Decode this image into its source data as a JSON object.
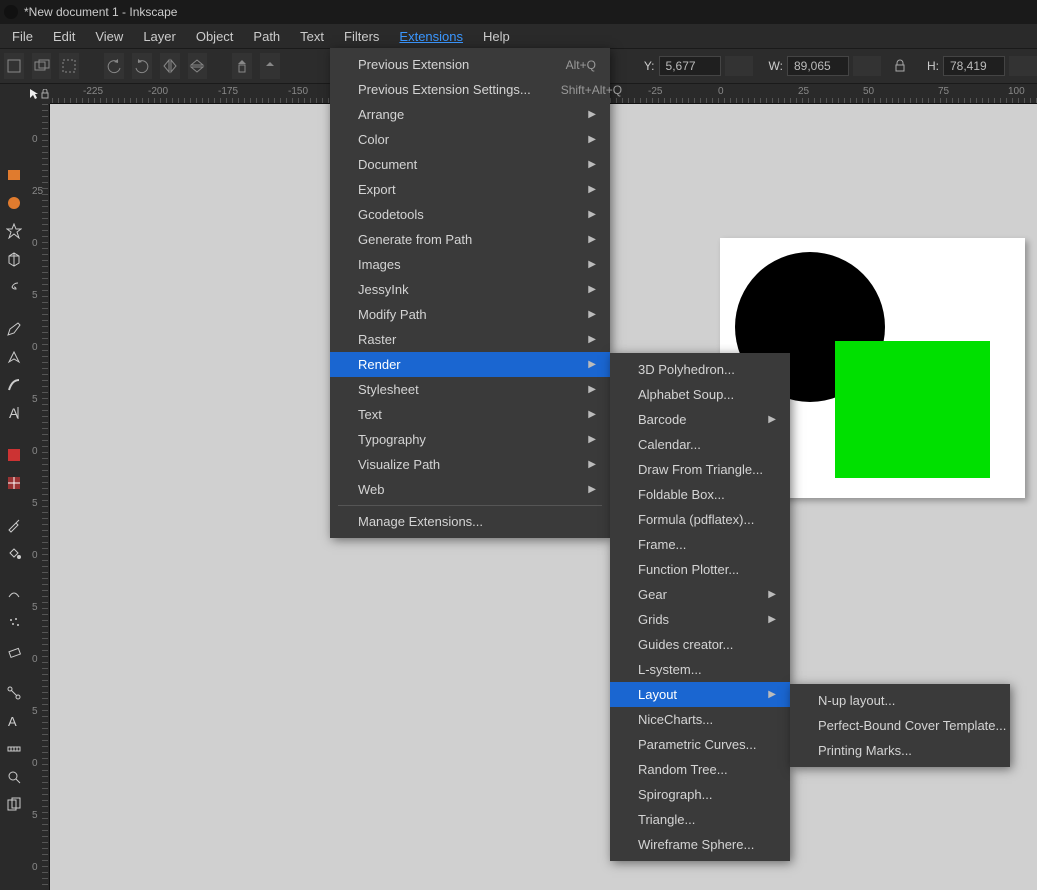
{
  "title": "*New document 1 - Inkscape",
  "menubar": [
    "File",
    "Edit",
    "View",
    "Layer",
    "Object",
    "Path",
    "Text",
    "Filters",
    "Extensions",
    "Help"
  ],
  "menubar_active": "Extensions",
  "coords": {
    "y_label": "Y:",
    "y": "5,677",
    "w_label": "W:",
    "w": "89,065",
    "h_label": "H:",
    "h": "78,419"
  },
  "ruler_h": [
    "-225",
    "-200",
    "-175",
    "-150",
    "-25",
    "0",
    "25",
    "50",
    "75",
    "100"
  ],
  "ruler_v": [
    "0",
    "25",
    "0",
    "5",
    "0",
    "5",
    "0",
    "5",
    "0",
    "5",
    "0",
    "5",
    "0",
    "5",
    "0"
  ],
  "ext_menu": [
    {
      "label": "Previous Extension",
      "shortcut": "Alt+Q"
    },
    {
      "label": "Previous Extension Settings...",
      "shortcut": "Shift+Alt+Q"
    },
    {
      "label": "Arrange",
      "sub": true
    },
    {
      "label": "Color",
      "sub": true
    },
    {
      "label": "Document",
      "sub": true
    },
    {
      "label": "Export",
      "sub": true
    },
    {
      "label": "Gcodetools",
      "sub": true
    },
    {
      "label": "Generate from Path",
      "sub": true
    },
    {
      "label": "Images",
      "sub": true
    },
    {
      "label": "JessyInk",
      "sub": true
    },
    {
      "label": "Modify Path",
      "sub": true
    },
    {
      "label": "Raster",
      "sub": true
    },
    {
      "label": "Render",
      "sub": true,
      "sel": true
    },
    {
      "label": "Stylesheet",
      "sub": true
    },
    {
      "label": "Text",
      "sub": true
    },
    {
      "label": "Typography",
      "sub": true
    },
    {
      "label": "Visualize Path",
      "sub": true
    },
    {
      "label": "Web",
      "sub": true
    },
    {
      "sep": true
    },
    {
      "label": "Manage Extensions..."
    }
  ],
  "render_menu": [
    {
      "label": "3D Polyhedron..."
    },
    {
      "label": "Alphabet Soup..."
    },
    {
      "label": "Barcode",
      "sub": true
    },
    {
      "label": "Calendar..."
    },
    {
      "label": "Draw From Triangle..."
    },
    {
      "label": "Foldable Box..."
    },
    {
      "label": "Formula (pdflatex)..."
    },
    {
      "label": "Frame..."
    },
    {
      "label": "Function Plotter..."
    },
    {
      "label": "Gear",
      "sub": true
    },
    {
      "label": "Grids",
      "sub": true
    },
    {
      "label": "Guides creator..."
    },
    {
      "label": "L-system..."
    },
    {
      "label": "Layout",
      "sub": true,
      "sel": true
    },
    {
      "label": "NiceCharts..."
    },
    {
      "label": "Parametric Curves..."
    },
    {
      "label": "Random Tree..."
    },
    {
      "label": "Spirograph..."
    },
    {
      "label": "Triangle..."
    },
    {
      "label": "Wireframe Sphere..."
    }
  ],
  "layout_menu": [
    {
      "label": "N-up layout..."
    },
    {
      "label": "Perfect-Bound Cover Template..."
    },
    {
      "label": "Printing Marks..."
    }
  ]
}
